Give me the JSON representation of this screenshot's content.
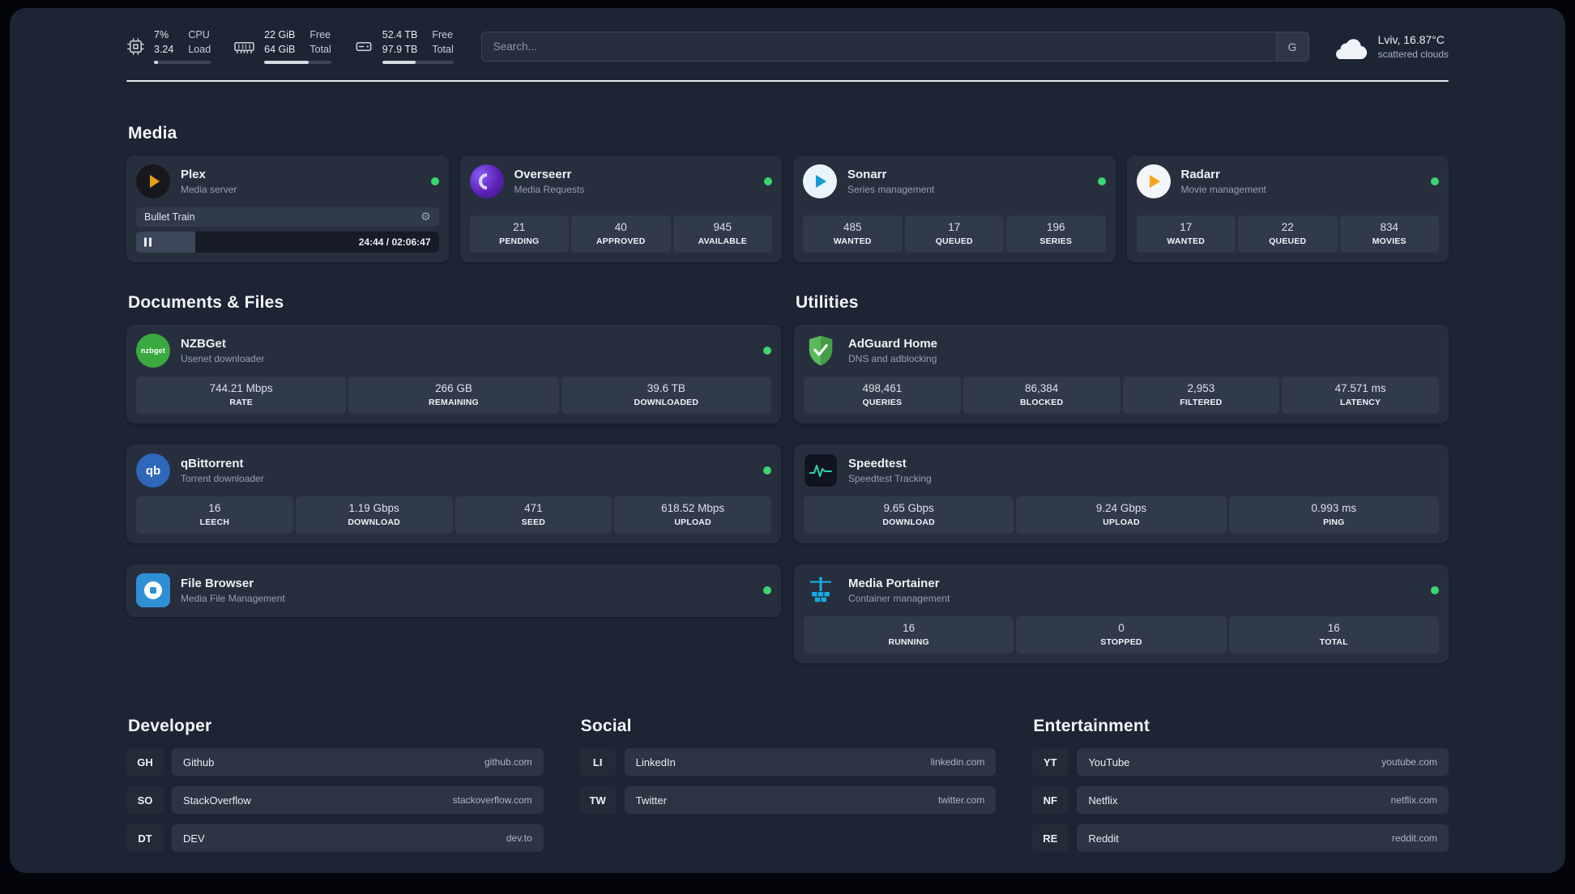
{
  "topbar": {
    "cpu": {
      "value_top": "7%",
      "value_bottom": "3.24",
      "label_top": "CPU",
      "label_bottom": "Load",
      "bar_style": "width:7%"
    },
    "ram": {
      "value_top": "22 GiB",
      "value_bottom": "64 GiB",
      "label_top": "Free",
      "label_bottom": "Total",
      "bar_style": "width:66%"
    },
    "disk": {
      "value_top": "52.4 TB",
      "value_bottom": "97.9 TB",
      "label_top": "Free",
      "label_bottom": "Total",
      "bar_style": "width:47%"
    },
    "search": {
      "placeholder": "Search...",
      "button_label": "G"
    },
    "weather": {
      "location": "Lviv, 16.87°C",
      "condition": "scattered clouds"
    }
  },
  "sections": {
    "media": {
      "title": "Media"
    },
    "documents": {
      "title": "Documents & Files"
    },
    "utilities": {
      "title": "Utilities"
    }
  },
  "services": {
    "plex": {
      "name": "Plex",
      "subtitle": "Media server",
      "now_playing": "Bullet Train",
      "elapsed": "24:44 / 02:06:47",
      "progress_style": "width:19.5%"
    },
    "overseerr": {
      "name": "Overseerr",
      "subtitle": "Media Requests",
      "stats": [
        {
          "value": "21",
          "label": "PENDING"
        },
        {
          "value": "40",
          "label": "APPROVED"
        },
        {
          "value": "945",
          "label": "AVAILABLE"
        }
      ]
    },
    "sonarr": {
      "name": "Sonarr",
      "subtitle": "Series management",
      "stats": [
        {
          "value": "485",
          "label": "WANTED"
        },
        {
          "value": "17",
          "label": "QUEUED"
        },
        {
          "value": "196",
          "label": "SERIES"
        }
      ]
    },
    "radarr": {
      "name": "Radarr",
      "subtitle": "Movie management",
      "stats": [
        {
          "value": "17",
          "label": "WANTED"
        },
        {
          "value": "22",
          "label": "QUEUED"
        },
        {
          "value": "834",
          "label": "MOVIES"
        }
      ]
    },
    "nzbget": {
      "name": "NZBGet",
      "subtitle": "Usenet downloader",
      "stats": [
        {
          "value": "744.21 Mbps",
          "label": "RATE"
        },
        {
          "value": "266 GB",
          "label": "REMAINING"
        },
        {
          "value": "39.6 TB",
          "label": "DOWNLOADED"
        }
      ]
    },
    "qbittorrent": {
      "name": "qBittorrent",
      "subtitle": "Torrent downloader",
      "stats": [
        {
          "value": "16",
          "label": "LEECH"
        },
        {
          "value": "1.19 Gbps",
          "label": "DOWNLOAD"
        },
        {
          "value": "471",
          "label": "SEED"
        },
        {
          "value": "618.52 Mbps",
          "label": "UPLOAD"
        }
      ]
    },
    "filebrowser": {
      "name": "File Browser",
      "subtitle": "Media File Management"
    },
    "adguard": {
      "name": "AdGuard Home",
      "subtitle": "DNS and adblocking",
      "stats": [
        {
          "value": "498,461",
          "label": "QUERIES"
        },
        {
          "value": "86,384",
          "label": "BLOCKED"
        },
        {
          "value": "2,953",
          "label": "FILTERED"
        },
        {
          "value": "47.571 ms",
          "label": "LATENCY"
        }
      ]
    },
    "speedtest": {
      "name": "Speedtest",
      "subtitle": "Speedtest Tracking",
      "stats": [
        {
          "value": "9.65 Gbps",
          "label": "DOWNLOAD"
        },
        {
          "value": "9.24 Gbps",
          "label": "UPLOAD"
        },
        {
          "value": "0.993 ms",
          "label": "PING"
        }
      ]
    },
    "portainer": {
      "name": "Media Portainer",
      "subtitle": "Container management",
      "stats": [
        {
          "value": "16",
          "label": "RUNNING"
        },
        {
          "value": "0",
          "label": "STOPPED"
        },
        {
          "value": "16",
          "label": "TOTAL"
        }
      ]
    }
  },
  "bookmarks": {
    "developer": {
      "title": "Developer",
      "items": [
        {
          "abbr": "GH",
          "name": "Github",
          "domain": "github.com"
        },
        {
          "abbr": "SO",
          "name": "StackOverflow",
          "domain": "stackoverflow.com"
        },
        {
          "abbr": "DT",
          "name": "DEV",
          "domain": "dev.to"
        }
      ]
    },
    "social": {
      "title": "Social",
      "items": [
        {
          "abbr": "LI",
          "name": "LinkedIn",
          "domain": "linkedin.com"
        },
        {
          "abbr": "TW",
          "name": "Twitter",
          "domain": "twitter.com"
        }
      ]
    },
    "entertainment": {
      "title": "Entertainment",
      "items": [
        {
          "abbr": "YT",
          "name": "YouTube",
          "domain": "youtube.com"
        },
        {
          "abbr": "NF",
          "name": "Netflix",
          "domain": "netflix.com"
        },
        {
          "abbr": "RE",
          "name": "Reddit",
          "domain": "reddit.com"
        }
      ]
    }
  }
}
